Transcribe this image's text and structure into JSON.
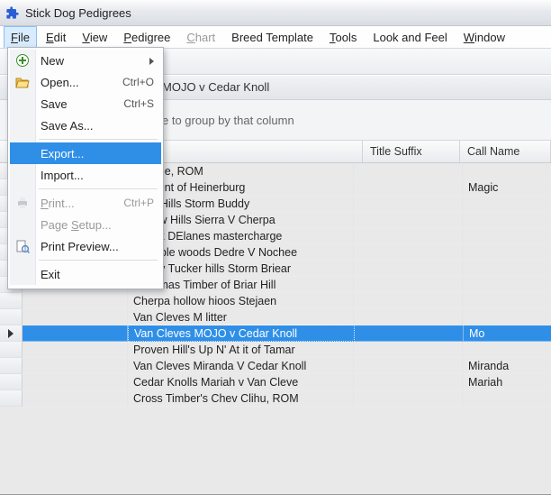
{
  "window": {
    "title": "Stick Dog Pedigrees"
  },
  "menubar": {
    "file": {
      "label": "File",
      "hotkey": "F"
    },
    "edit": {
      "label": "Edit",
      "hotkey": "E"
    },
    "view": {
      "label": "View",
      "hotkey": "V"
    },
    "pedigree": {
      "label": "Pedigree",
      "hotkey": "P"
    },
    "chart": {
      "label": "Chart",
      "hotkey": "C"
    },
    "breed": {
      "label": "Breed Template",
      "hotkey": ""
    },
    "tools": {
      "label": "Tools",
      "hotkey": "T"
    },
    "look": {
      "label": "Look and Feel",
      "hotkey": ""
    },
    "windowm": {
      "label": "Window",
      "hotkey": "W"
    }
  },
  "file_menu": {
    "new": {
      "label": "New",
      "accel": ""
    },
    "open": {
      "label": "Open...",
      "accel": "Ctrl+O"
    },
    "save": {
      "label": "Save",
      "accel": "Ctrl+S"
    },
    "save_as": {
      "label": "Save As...",
      "accel": ""
    },
    "export": {
      "label": "Export...",
      "accel": ""
    },
    "import": {
      "label": "Import...",
      "accel": ""
    },
    "print": {
      "label": "Print...",
      "accel": "Ctrl+P"
    },
    "page_setup": {
      "label": "Page Setup...",
      "accel": ""
    },
    "preview": {
      "label": "Print Preview...",
      "accel": ""
    },
    "exit": {
      "label": "Exit",
      "accel": ""
    }
  },
  "record_band": {
    "text": "MOJO v Cedar Knoll"
  },
  "groupby": {
    "hint": "e to group by that column"
  },
  "grid": {
    "columns": {
      "name": "",
      "suffix": "Title Suffix",
      "call": "Call Name"
    },
    "rows": [
      {
        "name": "Blondie, ROM",
        "suffix": "",
        "call": ""
      },
      {
        "name": "Moment of Heinerburg",
        "suffix": "",
        "call": "Magic"
      },
      {
        "name": "Brier Hills Storm Buddy",
        "suffix": "",
        "call": ""
      },
      {
        "name": "Hollow Hills Sierra V Cherpa",
        "suffix": "",
        "call": ""
      },
      {
        "name": "Kenkk DElanes mastercharge",
        "suffix": "",
        "call": ""
      },
      {
        "name": "Bramble woods Dedre V Nochee",
        "suffix": "",
        "call": ""
      },
      {
        "name": "Covey Tucker hills Storm Briear",
        "suffix": "",
        "call": ""
      },
      {
        "name": "Karizmas Timber of Briar Hill",
        "suffix": "",
        "call": ""
      },
      {
        "name": "Cherpa hollow hioos Stejaen",
        "suffix": "",
        "call": ""
      },
      {
        "name": "Van Cleves M litter",
        "suffix": "",
        "call": ""
      },
      {
        "name": "Van Cleves MOJO v Cedar Knoll",
        "suffix": "",
        "call": "Mo"
      },
      {
        "name": "Proven Hill's Up N' At it of Tamar",
        "suffix": "",
        "call": ""
      },
      {
        "name": "Van Cleves Miranda V Cedar Knoll",
        "suffix": "",
        "call": "Miranda"
      },
      {
        "name": "Cedar Knolls Mariah v Van Cleve",
        "suffix": "",
        "call": "Mariah"
      },
      {
        "name": "Cross Timber's Chev Clihu, ROM",
        "suffix": "",
        "call": ""
      }
    ],
    "selected_index": 10
  }
}
